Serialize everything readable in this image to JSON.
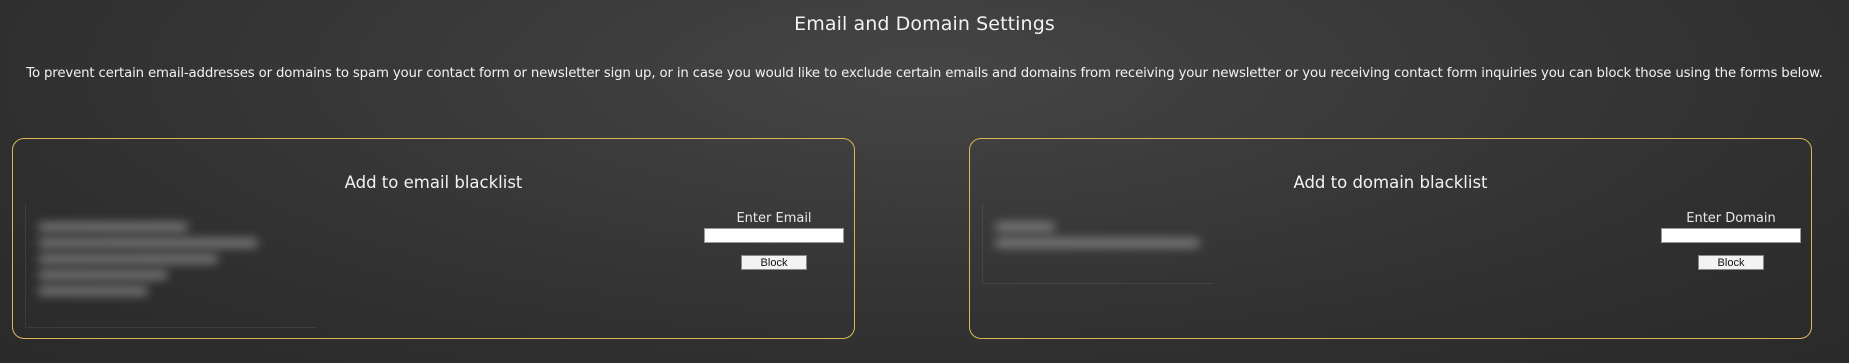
{
  "page": {
    "title": "Email and Domain Settings",
    "intro": "To prevent certain email-addresses or domains to spam your contact form or newsletter sign up, or in case you would like to exclude certain emails and domains from receiving your newsletter or you receiving contact form inquiries you can block those using the forms below."
  },
  "email_panel": {
    "title": "Add to email blacklist",
    "input_label": "Enter Email",
    "input_value": "",
    "button_label": "Block"
  },
  "domain_panel": {
    "title": "Add to domain blacklist",
    "input_label": "Enter Domain",
    "input_value": "",
    "button_label": "Block"
  },
  "colors": {
    "panel_border": "#d9b65a",
    "text": "#f2f2f2",
    "background": "#353535"
  }
}
